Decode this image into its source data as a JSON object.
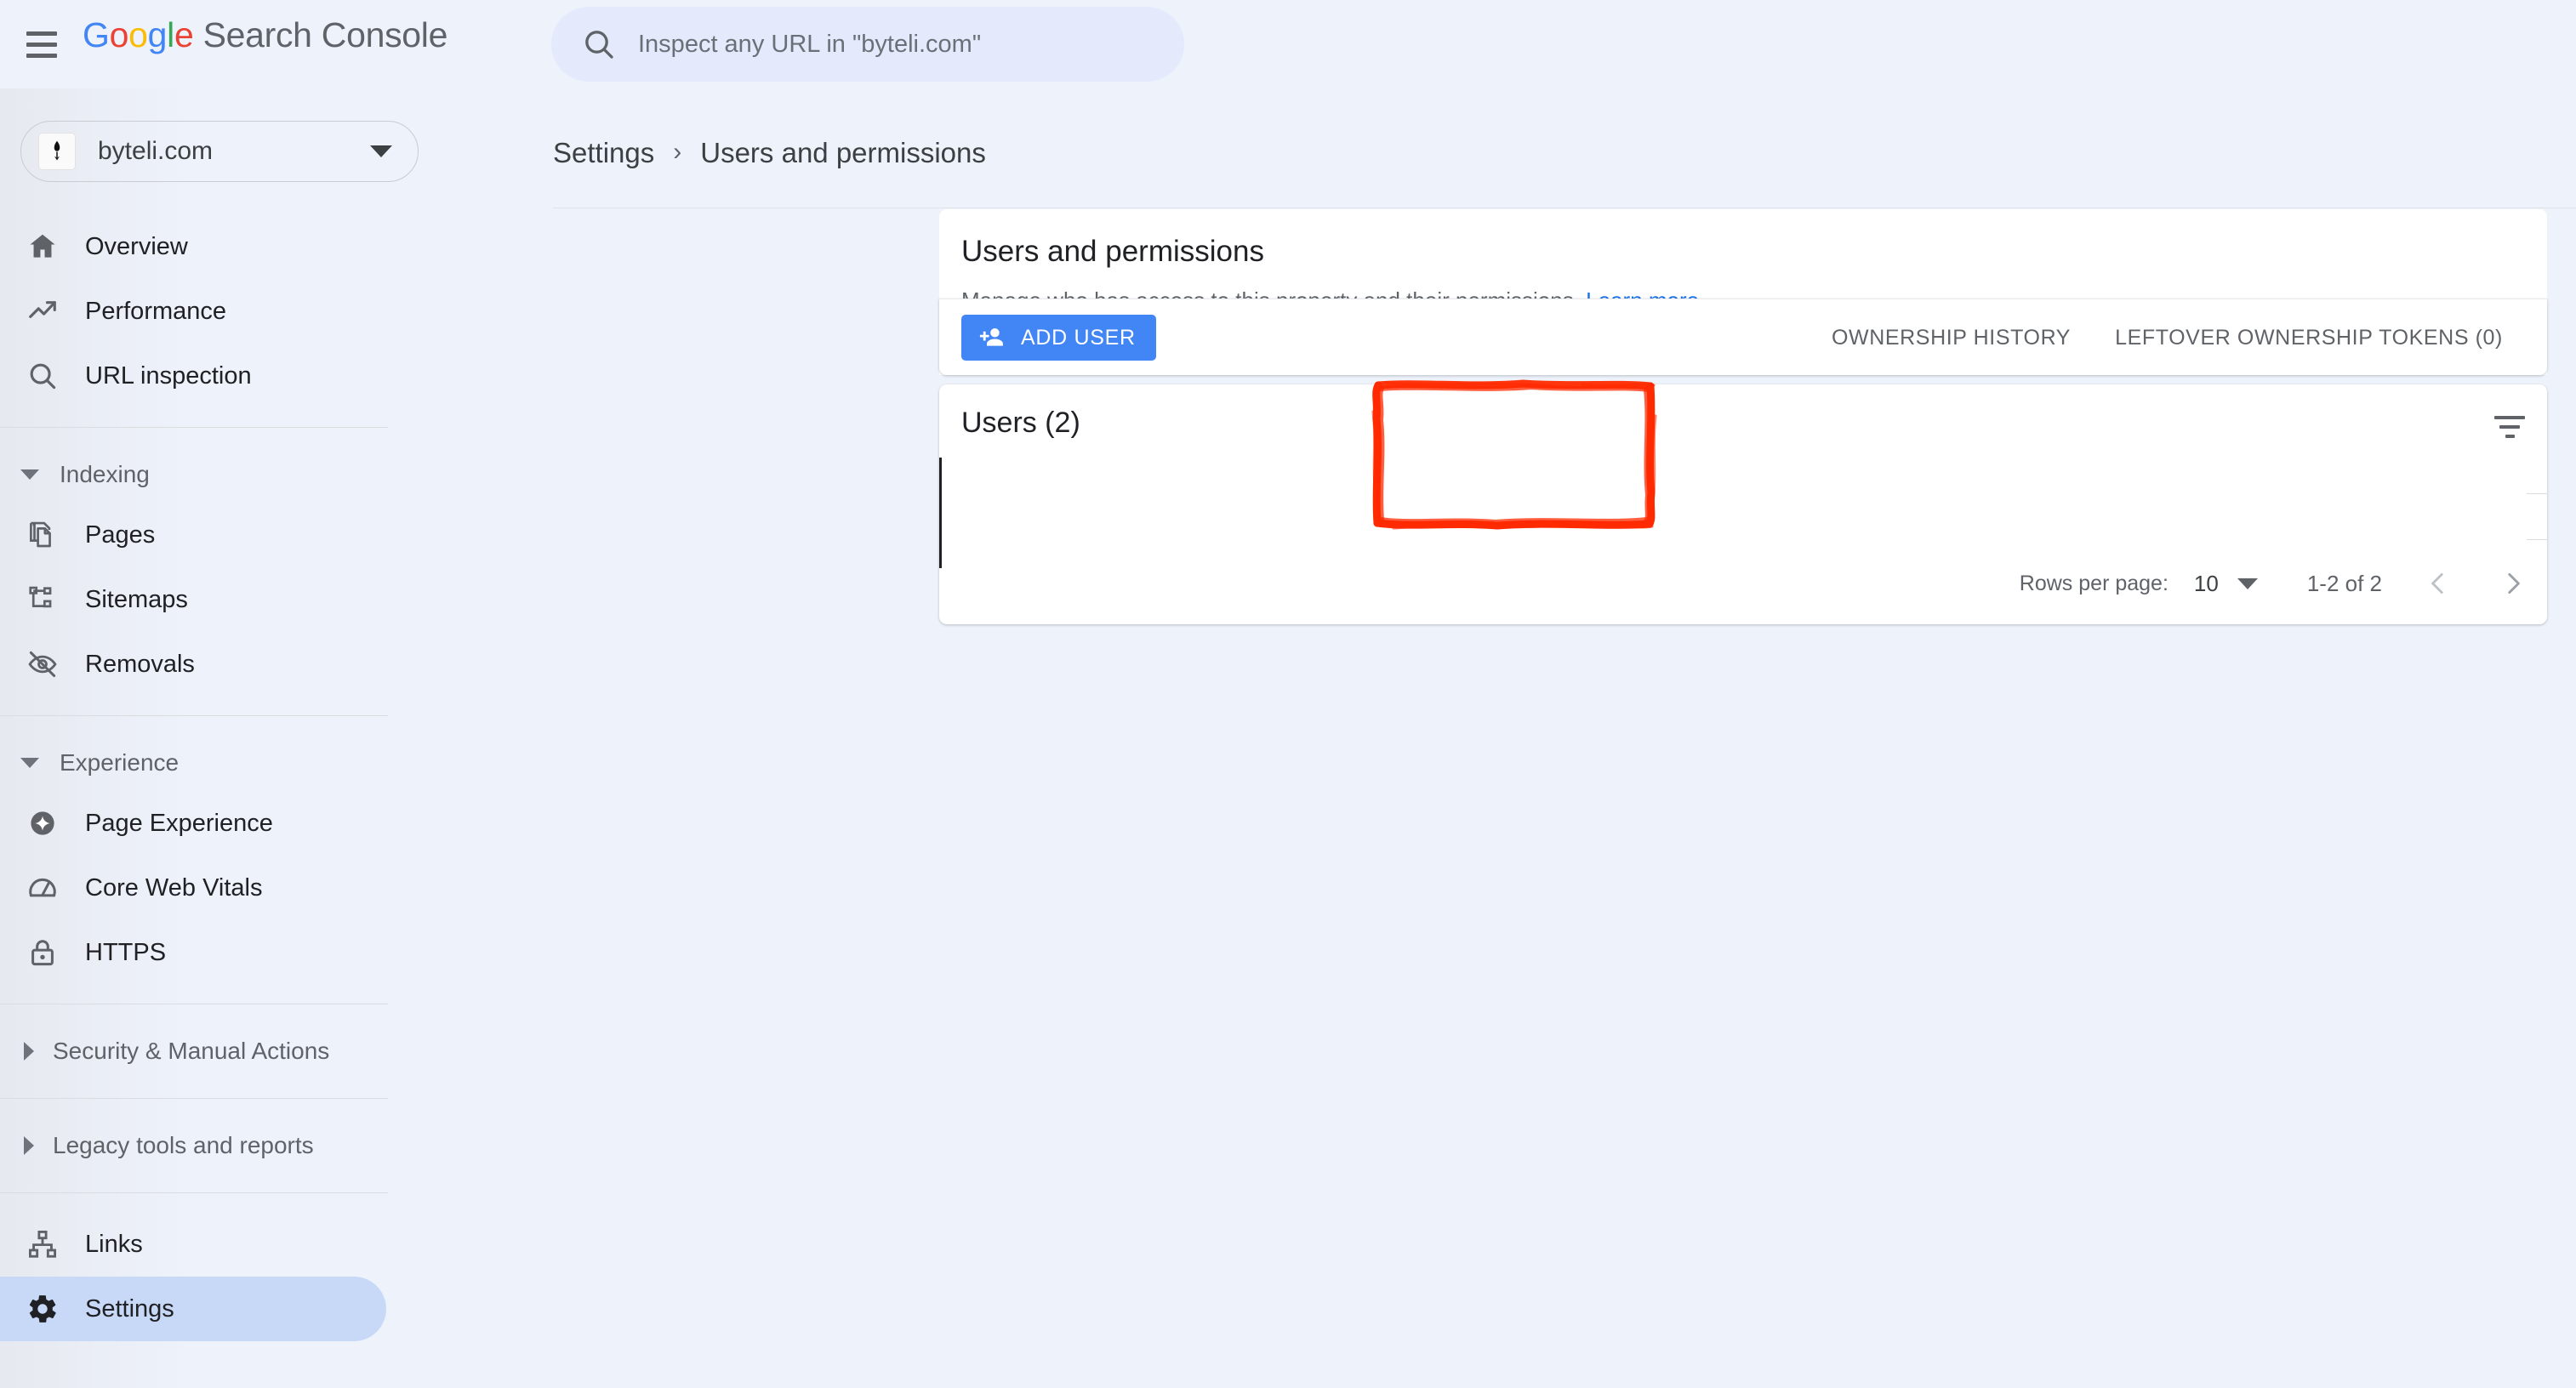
{
  "app": {
    "brand_google": "Google",
    "brand_suffix": "Search Console",
    "menu_icon": "hamburger-menu-icon"
  },
  "search": {
    "icon": "search-icon",
    "placeholder": "Inspect any URL in \"byteli.com\"",
    "value": ""
  },
  "property": {
    "name": "byteli.com",
    "icon": "site-favicon-icon",
    "caret_icon": "chevron-down-icon"
  },
  "sidebar": {
    "items": [
      {
        "label": "Overview",
        "icon": "home-icon",
        "active": false
      },
      {
        "label": "Performance",
        "icon": "trending-up-icon",
        "active": false
      },
      {
        "label": "URL inspection",
        "icon": "search-icon",
        "active": false
      }
    ],
    "sections": [
      {
        "label": "Indexing",
        "expanded": true,
        "items": [
          {
            "label": "Pages",
            "icon": "pages-copy-icon"
          },
          {
            "label": "Sitemaps",
            "icon": "sitemap-tree-icon"
          },
          {
            "label": "Removals",
            "icon": "eye-off-icon"
          }
        ]
      },
      {
        "label": "Experience",
        "expanded": true,
        "items": [
          {
            "label": "Page Experience",
            "icon": "page-experience-diamond-icon"
          },
          {
            "label": "Core Web Vitals",
            "icon": "speedometer-icon"
          },
          {
            "label": "HTTPS",
            "icon": "lock-icon"
          }
        ]
      },
      {
        "label": "Security & Manual Actions",
        "expanded": false,
        "items": []
      },
      {
        "label": "Legacy tools and reports",
        "expanded": false,
        "items": []
      }
    ],
    "footer_items": [
      {
        "label": "Links",
        "icon": "links-hierarchy-icon",
        "active": false
      },
      {
        "label": "Settings",
        "icon": "gear-icon",
        "active": true
      }
    ]
  },
  "breadcrumb": {
    "parent": "Settings",
    "separator": "›",
    "current": "Users and permissions"
  },
  "permissions_card": {
    "title": "Users and permissions",
    "description": "Manage who has access to this property and their permissions.",
    "learn_more": "Learn more"
  },
  "actions": {
    "add_user_label": "ADD USER",
    "add_user_icon": "person-add-icon",
    "ownership_history": "OWNERSHIP HISTORY",
    "leftover_tokens": "LEFTOVER OWNERSHIP TOKENS (0)"
  },
  "users_card": {
    "title": "Users (2)",
    "filter_icon": "filter-funnel-icon",
    "rows": []
  },
  "pagination": {
    "rows_per_page_label": "Rows per page:",
    "rows_per_page_value": "10",
    "range": "1-2 of 2",
    "prev_icon": "chevron-left-icon",
    "next_icon": "chevron-right-icon"
  },
  "annotation": {
    "shape": "rectangle",
    "color": "#FF2A00",
    "target": "add-user-button"
  },
  "colors": {
    "page_background": "#eef2fb",
    "card_background": "#ffffff",
    "accent_blue": "#4285f4",
    "link_blue": "#1a73e8",
    "active_nav": "#c8d9f8",
    "text_primary": "#202124",
    "text_secondary": "#5f6368",
    "annotation_red": "#FF2A00"
  }
}
